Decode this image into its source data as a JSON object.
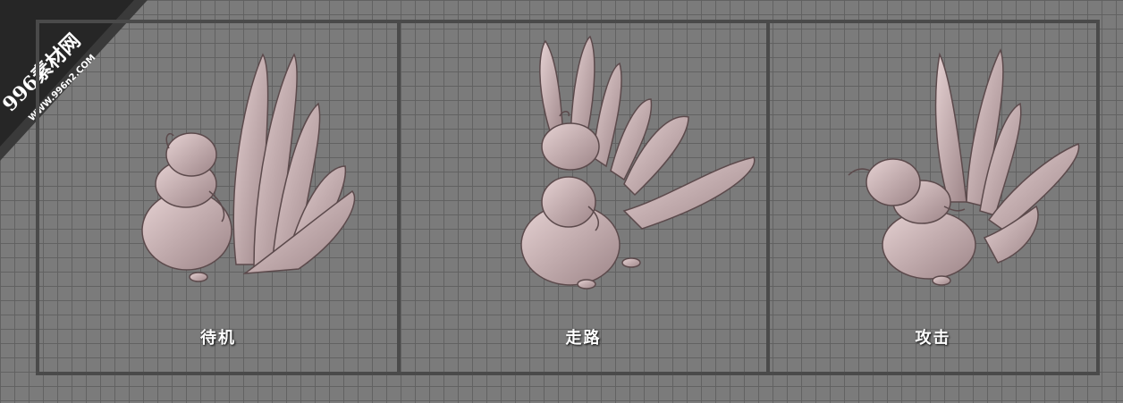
{
  "watermark": {
    "brand": "996素材网",
    "url": "WWW.996n2.COM"
  },
  "panels": [
    {
      "label": "待机"
    },
    {
      "label": "走路"
    },
    {
      "label": "攻击"
    }
  ],
  "colors": {
    "background": "#7b7b7b",
    "grid_line": "#5f5f5f",
    "frame": "#4a4a4a",
    "model_body": "#c9aeb0",
    "label_text": "#ffffff"
  }
}
